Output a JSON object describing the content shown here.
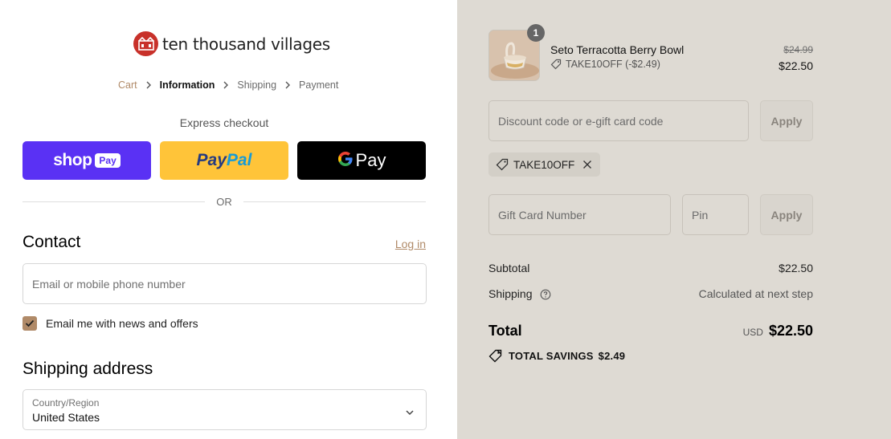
{
  "brand": {
    "name": "ten thousand villages",
    "color": "#c8312a"
  },
  "breadcrumb": [
    {
      "label": "Cart",
      "state": "link"
    },
    {
      "label": "Information",
      "state": "current"
    },
    {
      "label": "Shipping",
      "state": "upcoming"
    },
    {
      "label": "Payment",
      "state": "upcoming"
    }
  ],
  "express": {
    "title": "Express checkout",
    "shop": {
      "word": "shop",
      "badge": "Pay"
    },
    "paypal": {
      "p1": "Pay",
      "p2": "Pal"
    },
    "gpay": {
      "word": "Pay"
    },
    "or": "OR"
  },
  "contact": {
    "heading": "Contact",
    "login": "Log in",
    "email_placeholder": "Email or mobile phone number",
    "email_value": "",
    "newsletter_label": "Email me with news and offers",
    "newsletter_checked": true
  },
  "shipping": {
    "heading": "Shipping address",
    "country_label": "Country/Region",
    "country_value": "United States"
  },
  "summary": {
    "item": {
      "name": "Seto Terracotta Berry Bowl",
      "quantity": "1",
      "discount": "TAKE10OFF (-$2.49)",
      "original_price": "$24.99",
      "price": "$22.50"
    },
    "discount_placeholder": "Discount code or e-gift card code",
    "apply_label": "Apply",
    "applied_code": "TAKE10OFF",
    "gift_card_placeholder": "Gift Card Number",
    "pin_placeholder": "Pin",
    "subtotal_label": "Subtotal",
    "subtotal_value": "$22.50",
    "shipping_label": "Shipping",
    "shipping_value": "Calculated at next step",
    "total_label": "Total",
    "currency": "USD",
    "total_value": "$22.50",
    "savings_label": "TOTAL SAVINGS",
    "savings_value": "$2.49"
  },
  "colors": {
    "accent": "#b08a68",
    "shop_pay": "#5a31f4",
    "paypal": "#ffc439",
    "summary_bg": "#dedad3"
  },
  "icons": [
    "chevron-right-icon",
    "tag-icon",
    "close-icon",
    "help-circle-icon",
    "chevron-down-icon",
    "checkmark-icon",
    "google-g-icon"
  ]
}
